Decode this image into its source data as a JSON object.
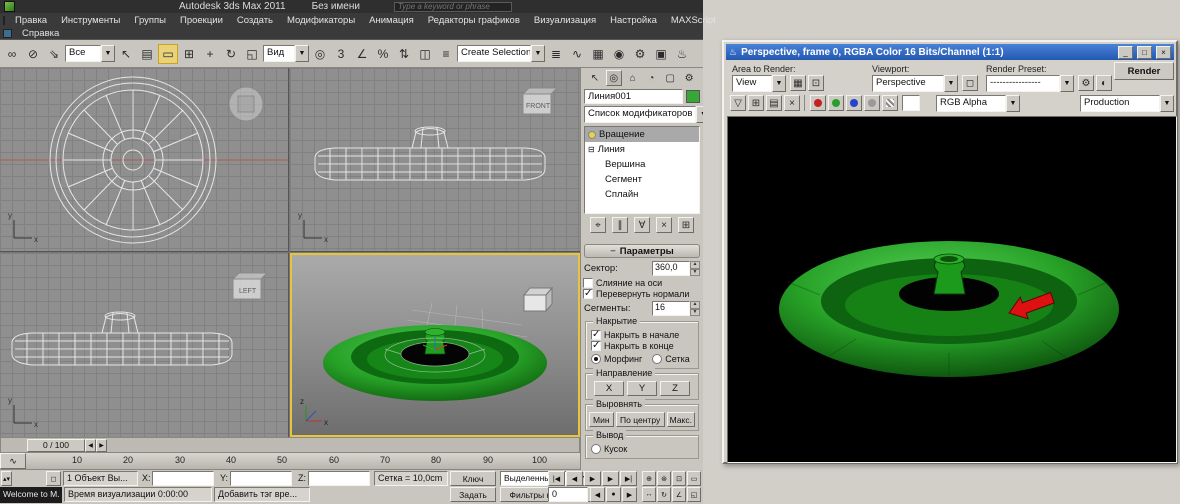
{
  "titlebar": {
    "product": "Autodesk 3ds Max  2011",
    "document": "Без имени",
    "search_placeholder": "Type a keyword or phrase"
  },
  "menubar": {
    "items": [
      "Правка",
      "Инструменты",
      "Группы",
      "Проекции",
      "Создать",
      "Модификаторы",
      "Анимация",
      "Редакторы графиков",
      "Визуализация",
      "Настройка",
      "MAXScript"
    ],
    "help": "Справка"
  },
  "main_toolbar": {
    "filter": "Все",
    "view": "Вид",
    "selection_set": "Create Selection Se"
  },
  "viewcubes": {
    "front": "FRONT",
    "left": "LEFT"
  },
  "command_panel": {
    "object_name": "Линия001",
    "modifier_list": "Список модификаторов",
    "stack_modifier": "Вращение",
    "stack_base": "Линия",
    "stack_sub1": "Вершина",
    "stack_sub2": "Сегмент",
    "stack_sub3": "Сплайн",
    "rollout": "Параметры",
    "degrees_label": "Сектор:",
    "degrees_value": "360,0",
    "weld_core": "Слияние на оси",
    "flip_normals": "Перевернуть нормали",
    "segments_label": "Сегменты:",
    "segments_value": "16",
    "capping_group": "Накрытие",
    "cap_start": "Накрыть в начале",
    "cap_end": "Накрыть в конце",
    "morph": "Морфинг",
    "grid_cap": "Сетка",
    "direction_group": "Направление",
    "dir_x": "X",
    "dir_y": "Y",
    "dir_z": "Z",
    "align_group": "Выровнять",
    "align_min": "Мин",
    "align_center": "По центру",
    "align_max": "Макс.",
    "output_group": "Вывод",
    "output_patch": "Кусок"
  },
  "timeline": {
    "slider": "0 / 100",
    "ticks": [
      "10",
      "20",
      "30",
      "40",
      "50",
      "60",
      "70",
      "80",
      "90",
      "100"
    ]
  },
  "status": {
    "objects": "1 Объект Вы...",
    "x": "X:",
    "y": "Y:",
    "z": "Z:",
    "grid": "Сетка = 10,0cm",
    "key": "Ключ",
    "set": "Задать",
    "selected": "Выделенные",
    "key_filters": "Фильтры ключей...",
    "welcome": "Welcome to M.",
    "render_time": "Время визуализации  0:00:00",
    "add_tag": "Добавить тэг вре...",
    "frame": "0"
  },
  "render_window": {
    "title": "Perspective, frame 0, RGBA Color 16 Bits/Channel (1:1)",
    "area_label": "Area to Render:",
    "area_value": "View",
    "viewport_label": "Viewport:",
    "viewport_value": "Perspective",
    "preset_label": "Render Preset:",
    "preset_value": "----------------",
    "render_button": "Render",
    "channel_value": "RGB Alpha",
    "production_value": "Production"
  },
  "colors": {
    "object_green": "#1f9e1f",
    "arrow_red": "#dd1111",
    "active_viewport_border": "#e8c43c"
  }
}
